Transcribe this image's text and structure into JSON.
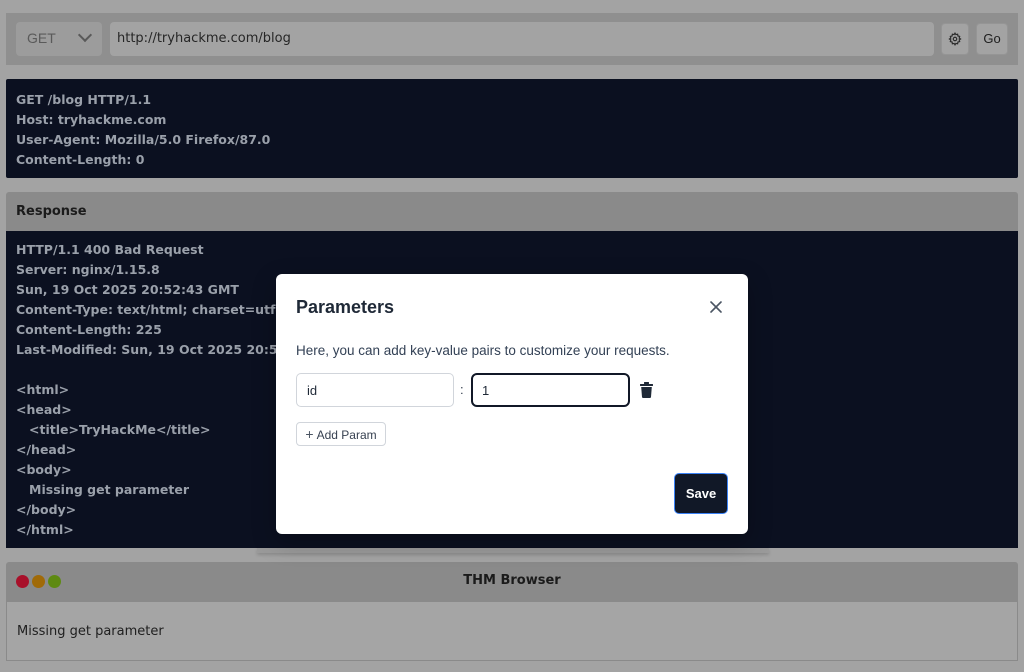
{
  "request_bar": {
    "method": "GET",
    "url": "http://tryhackme.com/blog",
    "settings_icon": "gear-icon",
    "go_label": "Go"
  },
  "request": {
    "lines": [
      "GET /blog HTTP/1.1",
      "Host: tryhackme.com",
      "User-Agent: Mozilla/5.0 Firefox/87.0",
      "Content-Length: 0"
    ]
  },
  "response": {
    "header": "Response",
    "lines": [
      "HTTP/1.1 400 Bad Request",
      "Server: nginx/1.15.8",
      "Sun, 19 Oct 2025 20:52:43 GMT",
      "Content-Type: text/html; charset=utf-8",
      "Content-Length: 225",
      "Last-Modified: Sun, 19 Oct 2025 20:52:43 GMT",
      "",
      "<html>",
      "<head>",
      "   <title>TryHackMe</title>",
      "</head>",
      "<body>",
      "   Missing get parameter",
      "</body>",
      "</html>"
    ]
  },
  "browser": {
    "title": "THM Browser",
    "content": "Missing get parameter",
    "dot_colors": [
      "#a8102a",
      "#a06a08",
      "#5e8a12"
    ]
  },
  "modal": {
    "title": "Parameters",
    "description": "Here, you can add key-value pairs to customize your requests.",
    "params": [
      {
        "key": "id",
        "value": "1"
      }
    ],
    "separator": ":",
    "add_param_label": "Add Param",
    "save_label": "Save",
    "close_icon": "close-icon",
    "delete_icon": "trash-icon"
  }
}
